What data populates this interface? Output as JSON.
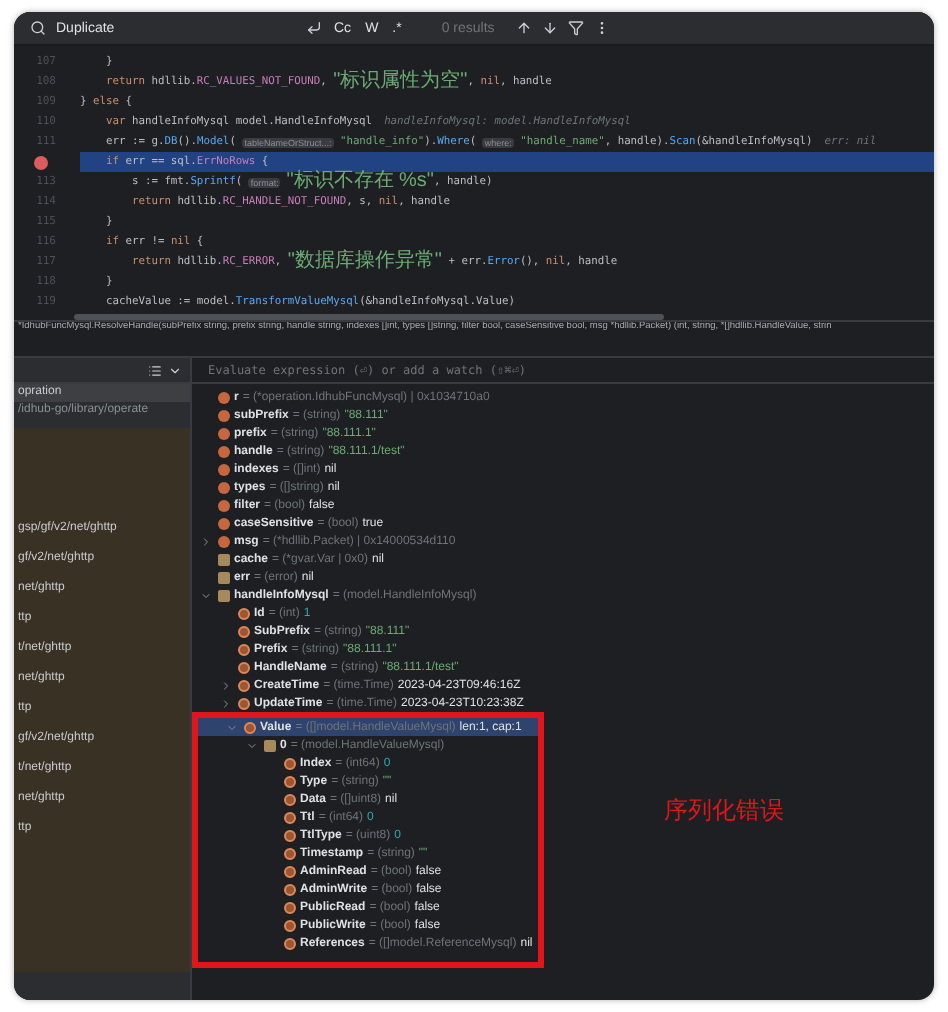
{
  "find_bar": {
    "query": "Duplicate",
    "options": [
      {
        "label": "Cc",
        "selected": false
      },
      {
        "label": "W",
        "selected": false
      },
      {
        "label": ".*",
        "selected": false
      }
    ],
    "results": "0 results"
  },
  "editor": {
    "lines": [
      {
        "number": "107",
        "breakpoint": false,
        "current": false,
        "tokens": [
          {
            "kind": "plain",
            "text": "    }"
          }
        ]
      },
      {
        "number": "108",
        "breakpoint": false,
        "current": false,
        "tokens": [
          {
            "kind": "keyword",
            "text": "    return "
          },
          {
            "kind": "plain",
            "text": "hdllib."
          },
          {
            "kind": "constant",
            "text": "RC_VALUES_NOT_FOUND"
          },
          {
            "kind": "plain",
            "text": ", "
          },
          {
            "kind": "string-cjk",
            "text": "\"标识属性为空\""
          },
          {
            "kind": "plain",
            "text": ", "
          },
          {
            "kind": "keyword",
            "text": "nil"
          },
          {
            "kind": "plain",
            "text": ", handle"
          }
        ]
      },
      {
        "number": "109",
        "breakpoint": false,
        "current": false,
        "tokens": [
          {
            "kind": "plain",
            "text": "} "
          },
          {
            "kind": "keyword",
            "text": "else"
          },
          {
            "kind": "plain",
            "text": " {"
          }
        ]
      },
      {
        "number": "110",
        "breakpoint": false,
        "current": false,
        "tokens": [
          {
            "kind": "keyword",
            "text": "    var "
          },
          {
            "kind": "plain",
            "text": "handleInfoMysql model.HandleInfoMysql"
          },
          {
            "kind": "value-hint",
            "text": "handleInfoMysql: model.HandleInfoMysql"
          }
        ]
      },
      {
        "number": "111",
        "breakpoint": false,
        "current": false,
        "tokens": [
          {
            "kind": "plain",
            "text": "    err := g."
          },
          {
            "kind": "func",
            "text": "DB"
          },
          {
            "kind": "plain",
            "text": "()."
          },
          {
            "kind": "func",
            "text": "Model"
          },
          {
            "kind": "plain",
            "text": "( "
          },
          {
            "kind": "param-hint",
            "text": "tableNameOrStruct...:"
          },
          {
            "kind": "string",
            "text": " \"handle_info\""
          },
          {
            "kind": "plain",
            "text": ")."
          },
          {
            "kind": "func",
            "text": "Where"
          },
          {
            "kind": "plain",
            "text": "( "
          },
          {
            "kind": "param-hint",
            "text": "where:"
          },
          {
            "kind": "string",
            "text": " \"handle_name\""
          },
          {
            "kind": "plain",
            "text": ", handle)."
          },
          {
            "kind": "func",
            "text": "Scan"
          },
          {
            "kind": "plain",
            "text": "(&handleInfoMysql)"
          },
          {
            "kind": "value-hint",
            "text": "err: nil"
          }
        ]
      },
      {
        "breakpoint": true,
        "current": true,
        "tokens": [
          {
            "kind": "keyword",
            "text": "    if "
          },
          {
            "kind": "plain",
            "text": "err == sql."
          },
          {
            "kind": "constant",
            "text": "ErrNoRows"
          },
          {
            "kind": "plain",
            "text": " {"
          }
        ]
      },
      {
        "number": "113",
        "breakpoint": false,
        "current": false,
        "tokens": [
          {
            "kind": "plain",
            "text": "        s := fmt."
          },
          {
            "kind": "func",
            "text": "Sprintf"
          },
          {
            "kind": "plain",
            "text": "( "
          },
          {
            "kind": "param-hint",
            "text": "format:"
          },
          {
            "kind": "string-cjk",
            "text": " \"标识不存在 %s\""
          },
          {
            "kind": "plain",
            "text": ", handle)"
          }
        ]
      },
      {
        "number": "114",
        "breakpoint": false,
        "current": false,
        "tokens": [
          {
            "kind": "keyword",
            "text": "        return "
          },
          {
            "kind": "plain",
            "text": "hdllib."
          },
          {
            "kind": "constant",
            "text": "RC_HANDLE_NOT_FOUND"
          },
          {
            "kind": "plain",
            "text": ", s, "
          },
          {
            "kind": "keyword",
            "text": "nil"
          },
          {
            "kind": "plain",
            "text": ", handle"
          }
        ]
      },
      {
        "number": "115",
        "breakpoint": false,
        "current": false,
        "tokens": [
          {
            "kind": "plain",
            "text": "    }"
          }
        ]
      },
      {
        "number": "116",
        "breakpoint": false,
        "current": false,
        "tokens": [
          {
            "kind": "keyword",
            "text": "    if "
          },
          {
            "kind": "plain",
            "text": "err != "
          },
          {
            "kind": "keyword",
            "text": "nil"
          },
          {
            "kind": "plain",
            "text": " {"
          }
        ]
      },
      {
        "number": "117",
        "breakpoint": false,
        "current": false,
        "tokens": [
          {
            "kind": "keyword",
            "text": "        return "
          },
          {
            "kind": "plain",
            "text": "hdllib."
          },
          {
            "kind": "constant",
            "text": "RC_ERROR"
          },
          {
            "kind": "plain",
            "text": ", "
          },
          {
            "kind": "string-cjk",
            "text": "\"数据库操作异常\""
          },
          {
            "kind": "plain",
            "text": " + err."
          },
          {
            "kind": "func",
            "text": "Error"
          },
          {
            "kind": "plain",
            "text": "(), "
          },
          {
            "kind": "keyword",
            "text": "nil"
          },
          {
            "kind": "plain",
            "text": ", handle"
          }
        ]
      },
      {
        "number": "118",
        "breakpoint": false,
        "current": false,
        "tokens": [
          {
            "kind": "plain",
            "text": "    }"
          }
        ]
      },
      {
        "number": "119",
        "breakpoint": false,
        "current": false,
        "tokens": [
          {
            "kind": "plain",
            "text": "    cacheValue := model."
          },
          {
            "kind": "func",
            "text": "TransformValueMysql"
          },
          {
            "kind": "plain",
            "text": "(&handleInfoMysql.Value)"
          }
        ]
      }
    ]
  },
  "signature": "*IdhubFuncMysql.ResolveHandle(subPrefix string, prefix string, handle string, indexes []int, types []string, filter bool, caseSensitive bool, msg *hdllib.Packet) (int, string, *[]hdllib.HandleValue, strin",
  "debugger": {
    "frames": [
      {
        "label": "opration",
        "selected": true,
        "kind": "app"
      },
      {
        "label": "/idhub-go/library/operate",
        "selected": false,
        "kind": "app"
      },
      {
        "label": "gsp/gf/v2/net/ghttp",
        "selected": false,
        "kind": "library"
      },
      {
        "label": "gf/v2/net/ghttp",
        "selected": false,
        "kind": "library"
      },
      {
        "label": "net/ghttp",
        "selected": false,
        "kind": "library"
      },
      {
        "label": "ttp",
        "selected": false,
        "kind": "library"
      },
      {
        "label": "t/net/ghttp",
        "selected": false,
        "kind": "library"
      },
      {
        "label": "net/ghttp",
        "selected": false,
        "kind": "library"
      },
      {
        "label": "ttp",
        "selected": false,
        "kind": "library"
      },
      {
        "label": "gf/v2/net/ghttp",
        "selected": false,
        "kind": "library"
      },
      {
        "label": "t/net/ghttp",
        "selected": false,
        "kind": "library"
      },
      {
        "label": "net/ghttp",
        "selected": false,
        "kind": "library"
      },
      {
        "label": "ttp",
        "selected": false,
        "kind": "library"
      }
    ],
    "evaluate": {
      "placeholder": "Evaluate expression (⏎) or add a watch (⇧⌘⏎)"
    },
    "variables": [
      {
        "kind": "param",
        "name": "r",
        "type": "= (*operation.IdhubFuncMysql) | 0x1034710a0",
        "selected": false
      },
      {
        "kind": "param",
        "name": "subPrefix",
        "type": "= (string)",
        "value": {
          "kind": "string",
          "text": "\"88.111\""
        },
        "selected": false
      },
      {
        "kind": "param",
        "name": "prefix",
        "type": "= (string)",
        "value": {
          "kind": "string",
          "text": "\"88.111.1\""
        },
        "selected": false
      },
      {
        "kind": "param",
        "name": "handle",
        "type": "= (string)",
        "value": {
          "kind": "string",
          "text": "\"88.111.1/test\""
        },
        "selected": false
      },
      {
        "kind": "param",
        "name": "indexes",
        "type": "= ([]int)",
        "value": {
          "kind": "plain",
          "text": "nil"
        },
        "selected": false
      },
      {
        "kind": "param",
        "name": "types",
        "type": "= ([]string)",
        "value": {
          "kind": "plain",
          "text": "nil"
        },
        "selected": false
      },
      {
        "kind": "param",
        "name": "filter",
        "type": "= (bool)",
        "value": {
          "kind": "plain",
          "text": "false"
        },
        "selected": false
      },
      {
        "kind": "param",
        "name": "caseSensitive",
        "type": "= (bool)",
        "value": {
          "kind": "plain",
          "text": "true"
        },
        "selected": false
      },
      {
        "kind": "param",
        "name": "msg",
        "type": "= (*hdllib.Packet) | 0x14000534d110",
        "selected": false,
        "expanded": false
      },
      {
        "kind": "local",
        "name": "cache",
        "type": "= (*gvar.Var | 0x0)",
        "value": {
          "kind": "plain",
          "text": "nil"
        },
        "selected": false
      },
      {
        "kind": "local",
        "name": "err",
        "type": "= (error)",
        "value": {
          "kind": "plain",
          "text": "nil"
        },
        "selected": false
      },
      {
        "kind": "local",
        "name": "handleInfoMysql",
        "type": "= (model.HandleInfoMysql)",
        "selected": false,
        "expanded": true,
        "children": [
          {
            "kind": "field",
            "name": "Id",
            "type": "= (int)",
            "value": {
              "kind": "number",
              "text": "1"
            },
            "selected": false
          },
          {
            "kind": "field",
            "name": "SubPrefix",
            "type": "= (string)",
            "value": {
              "kind": "string",
              "text": "\"88.111\""
            },
            "selected": false
          },
          {
            "kind": "field",
            "name": "Prefix",
            "type": "= (string)",
            "value": {
              "kind": "string",
              "text": "\"88.111.1\""
            },
            "selected": false
          },
          {
            "kind": "field",
            "name": "HandleName",
            "type": "= (string)",
            "value": {
              "kind": "string",
              "text": "\"88.111.1/test\""
            },
            "selected": false
          },
          {
            "kind": "field",
            "name": "CreateTime",
            "type": "= (time.Time)",
            "value": {
              "kind": "plain",
              "text": "2023-04-23T09:46:16Z"
            },
            "selected": false,
            "expanded": false
          },
          {
            "kind": "field",
            "name": "UpdateTime",
            "type": "= (time.Time)",
            "value": {
              "kind": "plain",
              "text": "2023-04-23T10:23:38Z"
            },
            "selected": false,
            "expanded": false
          },
          {
            "kind": "field",
            "name": "Value",
            "type": "= ([]model.HandleValueMysql)",
            "value": {
              "kind": "plain",
              "text": "len:1, cap:1"
            },
            "selected": true,
            "expanded": true,
            "boxed": true,
            "children": [
              {
                "kind": "local",
                "name": "0",
                "type": "= (model.HandleValueMysql)",
                "selected": false,
                "expanded": true,
                "children": [
                  {
                    "kind": "field",
                    "name": "Index",
                    "type": "= (int64)",
                    "value": {
                      "kind": "number",
                      "text": "0"
                    },
                    "selected": false
                  },
                  {
                    "kind": "field",
                    "name": "Type",
                    "type": "= (string)",
                    "value": {
                      "kind": "string",
                      "text": "\"\""
                    },
                    "selected": false
                  },
                  {
                    "kind": "field",
                    "name": "Data",
                    "type": "= ([]uint8)",
                    "value": {
                      "kind": "plain",
                      "text": "nil"
                    },
                    "selected": false
                  },
                  {
                    "kind": "field",
                    "name": "Ttl",
                    "type": "= (int64)",
                    "value": {
                      "kind": "number",
                      "text": "0"
                    },
                    "selected": false
                  },
                  {
                    "kind": "field",
                    "name": "TtlType",
                    "type": "= (uint8)",
                    "value": {
                      "kind": "number",
                      "text": "0"
                    },
                    "selected": false
                  },
                  {
                    "kind": "field",
                    "name": "Timestamp",
                    "type": "= (string)",
                    "value": {
                      "kind": "string",
                      "text": "\"\""
                    },
                    "selected": false
                  },
                  {
                    "kind": "field",
                    "name": "AdminRead",
                    "type": "= (bool)",
                    "value": {
                      "kind": "plain",
                      "text": "false"
                    },
                    "selected": false
                  },
                  {
                    "kind": "field",
                    "name": "AdminWrite",
                    "type": "= (bool)",
                    "value": {
                      "kind": "plain",
                      "text": "false"
                    },
                    "selected": false
                  },
                  {
                    "kind": "field",
                    "name": "PublicRead",
                    "type": "= (bool)",
                    "value": {
                      "kind": "plain",
                      "text": "false"
                    },
                    "selected": false
                  },
                  {
                    "kind": "field",
                    "name": "PublicWrite",
                    "type": "= (bool)",
                    "value": {
                      "kind": "plain",
                      "text": "false"
                    },
                    "selected": false
                  },
                  {
                    "kind": "field",
                    "name": "References",
                    "type": "= ([]model.ReferenceMysql)",
                    "value": {
                      "kind": "plain",
                      "text": "nil"
                    },
                    "selected": false
                  }
                ]
              }
            ]
          }
        ]
      }
    ],
    "annotation": "序列化错误"
  }
}
